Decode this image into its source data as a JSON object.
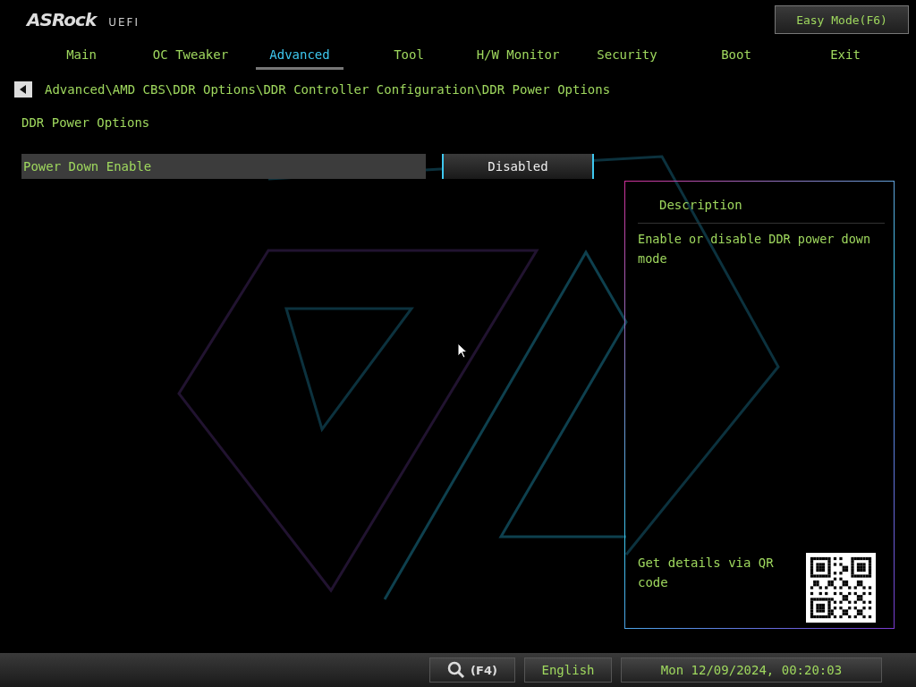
{
  "logo": {
    "brand": "ASRock",
    "product": "UEFI"
  },
  "easy_mode_button": "Easy Mode(F6)",
  "tabs": [
    {
      "label": "Main",
      "selected": false
    },
    {
      "label": "OC Tweaker",
      "selected": false
    },
    {
      "label": "Advanced",
      "selected": true
    },
    {
      "label": "Tool",
      "selected": false
    },
    {
      "label": "H/W Monitor",
      "selected": false
    },
    {
      "label": "Security",
      "selected": false
    },
    {
      "label": "Boot",
      "selected": false
    },
    {
      "label": "Exit",
      "selected": false
    }
  ],
  "breadcrumb": "Advanced\\AMD CBS\\DDR Options\\DDR Controller Configuration\\DDR Power Options",
  "page_title": "DDR Power Options",
  "options": [
    {
      "label": "Power Down Enable",
      "value": "Disabled",
      "selected": true
    }
  ],
  "description": {
    "title": "Description",
    "text": "Enable or disable DDR power down mode",
    "qr_text": "Get details via QR code"
  },
  "status_bar": {
    "search_key": "(F4)",
    "language": "English",
    "datetime": "Mon 12/09/2024, 00:20:03"
  }
}
